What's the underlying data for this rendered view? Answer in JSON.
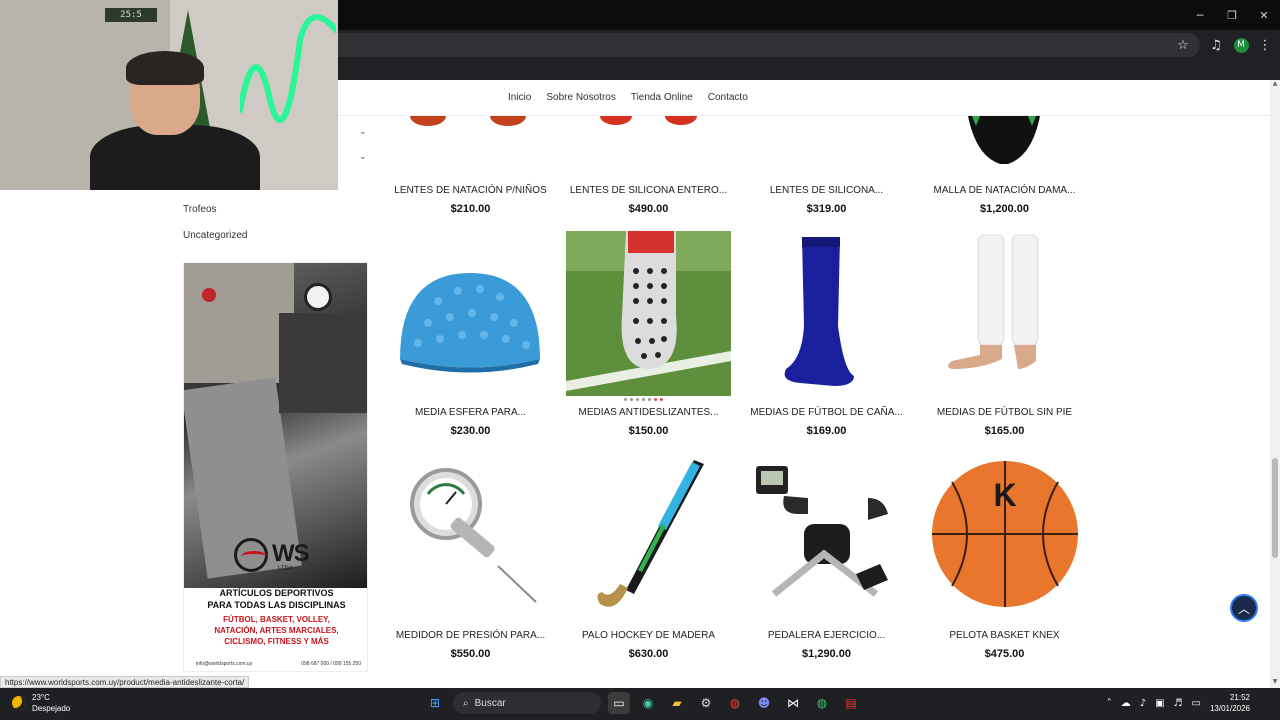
{
  "webcam": {
    "clock_text": "25:5"
  },
  "window_controls": {
    "minimize": "─",
    "restore": "❐",
    "close": "✕"
  },
  "toolbar": {
    "profile_initial": "M"
  },
  "nav": [
    "Inicio",
    "Sobre Nosotros",
    "Tienda Online",
    "Contacto"
  ],
  "sidebar": {
    "links": [
      "Trofeos",
      "Uncategorized"
    ],
    "banner": {
      "logo_text": "WS",
      "logo_sub": "LTDA",
      "line1": "ARTÍCULOS DEPORTIVOS",
      "line2": "PARA TODAS LAS DISCIPLINAS",
      "line3": "FÚTBOL, BASKET, VOLLEY,",
      "line4": "NATACIÓN, ARTES MARCIALES,",
      "line5": "CICLISMO, FITNESS Y MÁS",
      "email": "info@worldsports.com.uy",
      "phones": "098 687 000 / 099 155 250"
    }
  },
  "products": [
    {
      "name": "LENTES DE NATACIÓN P/NIÑOS",
      "price": "$210.00",
      "icon": "goggles-icon"
    },
    {
      "name": "LENTES DE SILICONA ENTERO...",
      "price": "$490.00",
      "icon": "goggles-icon"
    },
    {
      "name": "LENTES DE SILICONA...",
      "price": "$319.00",
      "icon": "goggles-icon"
    },
    {
      "name": "MALLA DE NATACIÓN DAMA...",
      "price": "$1,200.00",
      "icon": "swimsuit-icon"
    },
    {
      "name": "MEDIA ESFERA PARA...",
      "price": "$230.00",
      "icon": "balance-dome-icon"
    },
    {
      "name": "MEDIAS ANTIDESLIZANTES...",
      "price": "$150.00",
      "icon": "grip-sock-icon"
    },
    {
      "name": "MEDIAS DE FÚTBOL DE CAÑA...",
      "price": "$169.00",
      "icon": "football-sock-icon"
    },
    {
      "name": "MEDIAS DE FÚTBOL SIN PIE",
      "price": "$165.00",
      "icon": "footless-sock-icon"
    },
    {
      "name": "MEDIDOR DE PRESIÓN PARA...",
      "price": "$550.00",
      "icon": "pressure-gauge-icon"
    },
    {
      "name": "PALO HOCKEY DE MADERA",
      "price": "$630.00",
      "icon": "hockey-stick-icon"
    },
    {
      "name": "PEDALERA EJERCICIO...",
      "price": "$1,290.00",
      "icon": "pedal-exerciser-icon"
    },
    {
      "name": "PELOTA BASKET KNEX",
      "price": "$475.00",
      "icon": "basketball-icon"
    }
  ],
  "status_url": "https://www.worldsports.com.uy/product/media-antideslizante-corta/",
  "taskbar": {
    "temperature": "23°C",
    "weather": "Despejado",
    "search_label": "Buscar",
    "time": "21:52",
    "date": "13/01/2026"
  },
  "colors": {
    "accent_red": "#c8141c",
    "nav_dark": "#1b2a4a",
    "scroll_ring": "#2e7cf6"
  }
}
